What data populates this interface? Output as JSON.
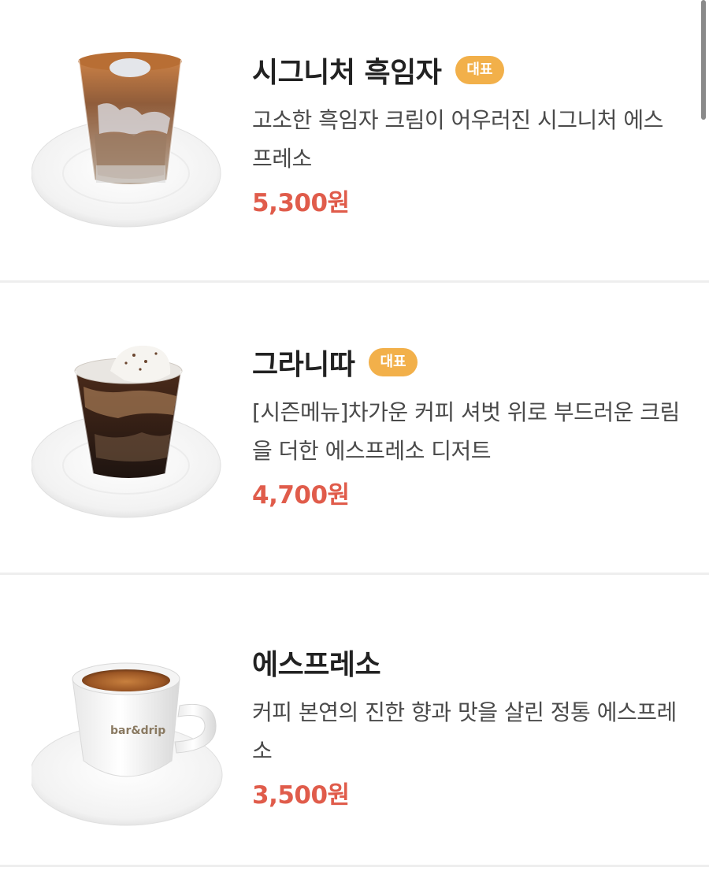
{
  "menu": {
    "items": [
      {
        "name": "시그니처 흑임자",
        "badge": "대표",
        "description": "고소한 흑임자 크림이 어우러진 시그니처 에스프레소",
        "price": "5,300원",
        "image": "signature-black-sesame-glass"
      },
      {
        "name": "그라니따",
        "badge": "대표",
        "description": "[시즌메뉴]차가운 커피 셔벗 위로 부드러운 크림을 더한 에스프레소 디저트",
        "price": "4,700원",
        "image": "granita-glass"
      },
      {
        "name": "에스프레소",
        "description": "커피 본연의 진한 향과 맛을 살린 정통 에스프레소",
        "price": "3,500원",
        "image": "espresso-cup",
        "cup_text": "bar&drip"
      }
    ]
  },
  "colors": {
    "badge": "#f2b04a",
    "price": "#e05c4b",
    "divider": "#eeeeee"
  }
}
